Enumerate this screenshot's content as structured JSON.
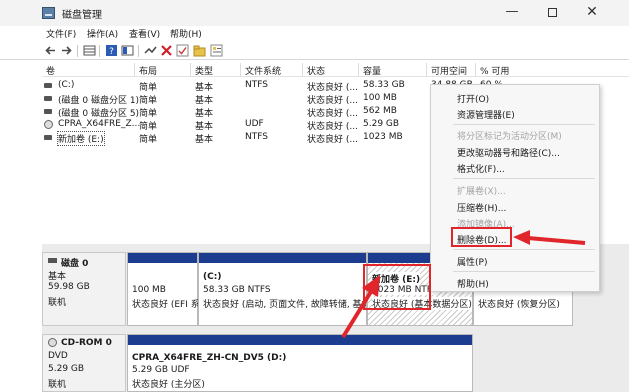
{
  "window": {
    "title": "磁盘管理",
    "min": "—",
    "close": "✕"
  },
  "menu": [
    "文件(F)",
    "操作(A)",
    "查看(V)",
    "帮助(H)"
  ],
  "toolbar_icons": [
    "back-arrow-icon",
    "forward-arrow-icon",
    "volume-list-icon",
    "help-icon",
    "disk-view-icon",
    "connect-icon",
    "delete-x-icon",
    "check-icon",
    "folder-icon",
    "properties-icon"
  ],
  "columns": [
    "卷",
    "布局",
    "类型",
    "文件系统",
    "状态",
    "容量",
    "可用空间",
    "% 可用"
  ],
  "volumes": [
    {
      "name": "(C:)",
      "layout": "简单",
      "type": "基本",
      "fs": "NTFS",
      "status": "状态良好 (...",
      "capacity": "58.33 GB",
      "free": "34.88 GB",
      "pct": "60 %"
    },
    {
      "name": "(磁盘 0 磁盘分区 1)",
      "layout": "简单",
      "type": "基本",
      "fs": "",
      "status": "状态良好 (...",
      "capacity": "100 MB",
      "free": "",
      "pct": ""
    },
    {
      "name": "(磁盘 0 磁盘分区 5)",
      "layout": "简单",
      "type": "基本",
      "fs": "",
      "status": "状态良好 (...",
      "capacity": "562 MB",
      "free": "",
      "pct": ""
    },
    {
      "name": "CPRA_X64FRE_Z...",
      "layout": "简单",
      "type": "基本",
      "fs": "UDF",
      "status": "状态良好 (...",
      "capacity": "5.29 GB",
      "free": "",
      "pct": ""
    },
    {
      "name": "新加卷 (E:)",
      "layout": "简单",
      "type": "基本",
      "fs": "NTFS",
      "status": "状态良好 (...",
      "capacity": "1023 MB",
      "free": "",
      "pct": ""
    }
  ],
  "disk0": {
    "name": "磁盘 0",
    "type": "基本",
    "size": "59.98 GB",
    "state": "联机",
    "partitions": [
      {
        "line1": "",
        "line2": "100 MB",
        "line3": "状态良好 (EFI 系"
      },
      {
        "line1": "(C:)",
        "line2": "58.33 GB NTFS",
        "line3": "状态良好 (启动, 页面文件, 故障转储, 基本"
      },
      {
        "line1": "新加卷 (E:)",
        "line2": "1023 MB NTFS",
        "line3": "状态良好 (基本数据分区)"
      },
      {
        "line1": "",
        "line2": "",
        "line3": "状态良好 (恢复分区)"
      }
    ]
  },
  "cdrom0": {
    "name": "CD-ROM 0",
    "type": "DVD",
    "size": "5.29 GB",
    "state": "联机",
    "partition": {
      "line1": "CPRA_X64FRE_ZH-CN_DV5 (D:)",
      "line2": "5.29 GB UDF",
      "line3": "状态良好 (主分区)"
    }
  },
  "context_menu": [
    {
      "label": "打开(O)",
      "disabled": false
    },
    {
      "label": "资源管理器(E)",
      "disabled": false
    },
    {
      "label": "将分区标记为活动分区(M)",
      "disabled": true
    },
    {
      "label": "更改驱动器号和路径(C)...",
      "disabled": false
    },
    {
      "label": "格式化(F)...",
      "disabled": false
    },
    {
      "label": "扩展卷(X)...",
      "disabled": true
    },
    {
      "label": "压缩卷(H)...",
      "disabled": false
    },
    {
      "label": "添加镜像(A)...",
      "disabled": true
    },
    {
      "label": "删除卷(D)...",
      "disabled": false
    },
    {
      "label": "属性(P)",
      "disabled": false
    },
    {
      "label": "帮助(H)",
      "disabled": false
    }
  ],
  "colors": {
    "partition_bar": "#1b3c8f",
    "highlight": "#e0252b"
  }
}
